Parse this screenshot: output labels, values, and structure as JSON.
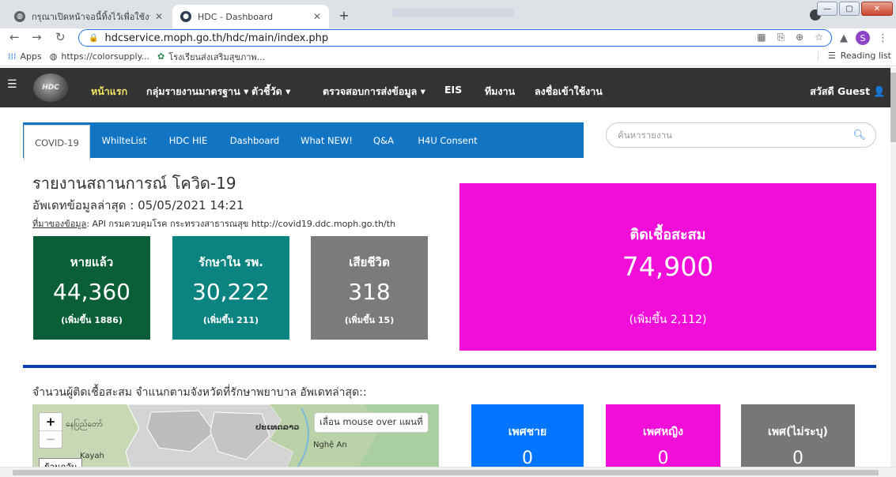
{
  "browser": {
    "tabs": [
      {
        "title": "กรุณาเปิดหน้าจอนี้ทิ้งไว้เพื่อใช้งาน Inte"
      },
      {
        "title": "HDC - Dashboard"
      }
    ],
    "new_tab": "+",
    "url": "hdcservice.moph.go.th/hdc/main/index.php",
    "profile_initial": "S",
    "bookmarks": [
      {
        "label": "Apps",
        "icon": "apps-grid-icon"
      },
      {
        "label": "https://colorsupply...",
        "icon": "globe-icon"
      },
      {
        "label": "โรงเรียนส่งเสริมสุขภาพ...",
        "icon": "school-icon"
      }
    ],
    "reading_list": "Reading list"
  },
  "site_nav": {
    "home": "หน้าแรก",
    "items": [
      "กลุ่มรายงานมาตรฐาน ▾",
      "ตัวชี้วัด ▾",
      "ตรวจสอบการส่งข้อมูล ▾",
      "EIS",
      "ทีมงาน",
      "ลงชื่อเข้าใช้งาน"
    ],
    "greeting": "สวัสดี Guest"
  },
  "tabs": [
    "COVID-19",
    "WhilteList",
    "HDC HIE",
    "Dashboard",
    "What NEW!",
    "Q&A",
    "H4U Consent"
  ],
  "search": {
    "placeholder": "ค้นหารายงาน"
  },
  "report": {
    "title": "รายงานสถานการณ์ โควิด-19",
    "updated": "อัพเดทข้อมูลล่าสุด : 05/05/2021 14:21",
    "source_label": "ที่มาของข้อมูล",
    "source_text": ": API กรมควบคุมโรค กระทรวงสาธารณสุข http://covid19.ddc.moph.go.th/th"
  },
  "stats": {
    "recovered": {
      "label": "หายแล้ว",
      "value": "44,360",
      "delta": "(เพิ่มขึ้น 1886)",
      "color": "#0a5e38"
    },
    "hospitalized": {
      "label": "รักษาใน รพ.",
      "value": "30,222",
      "delta": "(เพิ่มขึ้น 211)",
      "color": "#0b8380"
    },
    "deaths": {
      "label": "เสียชีวิต",
      "value": "318",
      "delta": "(เพิ่มขึ้น 15)",
      "color": "#7b7b7b"
    },
    "total": {
      "label": "ติดเชื้อสะสม",
      "value": "74,900",
      "delta": "(เพิ่มขึ้น 2,112)",
      "color": "#f20ed9"
    }
  },
  "province_section": {
    "heading": "จำนวนผู้ติดเชื้อสะสม จำแนกตามจังหวัดที่รักษาพยาบาล อัพเดทล่าสุด::",
    "map": {
      "zoom_in": "+",
      "zoom_out": "−",
      "back": "ย้อนกลับ",
      "hint": "เลื่อน mouse over แผนที่",
      "labels": [
        "နေပြည်တော်",
        "ປະເທດລາວ",
        "Nghệ An",
        "Kayah"
      ]
    },
    "gender": {
      "male": {
        "label": "เพศชาย",
        "value": "0",
        "color": "#0475ff"
      },
      "female": {
        "label": "เพศหญิง",
        "value": "0",
        "color": "#f20ed9"
      },
      "unknown": {
        "label": "เพศ(ไม่ระบุ)",
        "value": "0",
        "color": "#777777"
      }
    }
  }
}
